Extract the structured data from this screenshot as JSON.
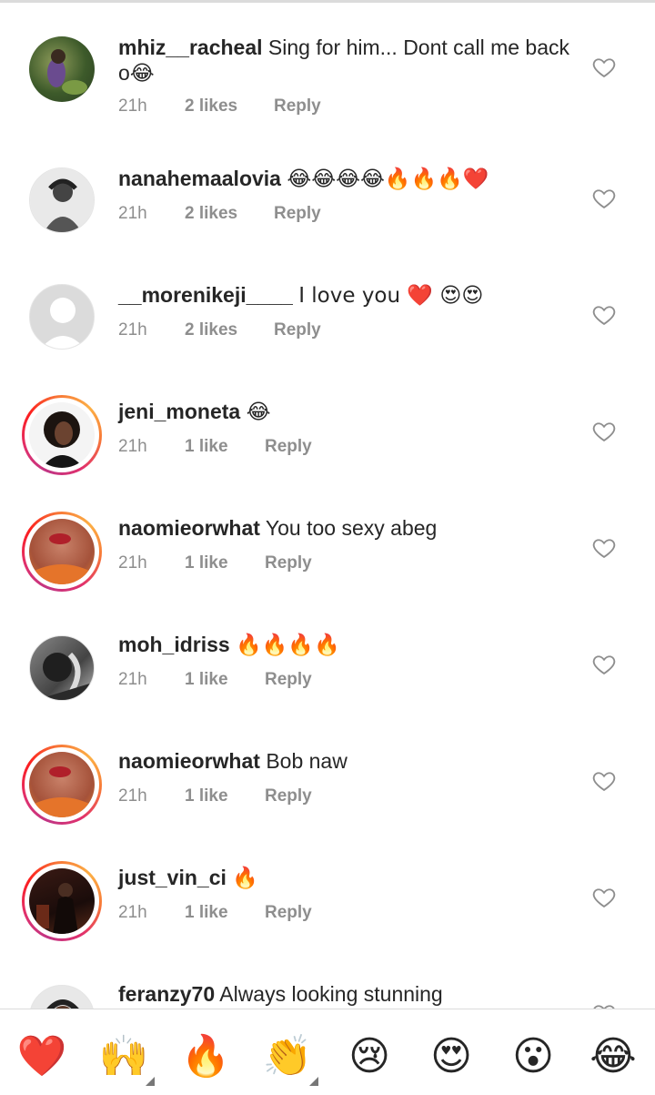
{
  "comments": [
    {
      "username": "mhiz__racheal",
      "text": "Sing for him... Dont call me back o😂",
      "time": "21h",
      "likes": "2 likes",
      "reply": "Reply",
      "avatar": "photo"
    },
    {
      "username": "nanahemaalovia",
      "text": "😂😂😂😂🔥🔥🔥❤️",
      "time": "21h",
      "likes": "2 likes",
      "reply": "Reply",
      "avatar": "photo"
    },
    {
      "username": "__morenikeji____",
      "text": "I love you ❤️ 😍😍",
      "time": "21h",
      "likes": "2 likes",
      "reply": "Reply",
      "avatar": "default-placeholder"
    },
    {
      "username": "jeni_moneta",
      "text": "😂",
      "time": "21h",
      "likes": "1 like",
      "reply": "Reply",
      "avatar": "story-ring"
    },
    {
      "username": "naomieorwhat",
      "text": "You too sexy abeg",
      "time": "21h",
      "likes": "1 like",
      "reply": "Reply",
      "avatar": "story-ring"
    },
    {
      "username": "moh_idriss",
      "text": "🔥🔥🔥🔥",
      "time": "21h",
      "likes": "1 like",
      "reply": "Reply",
      "avatar": "photo"
    },
    {
      "username": "naomieorwhat",
      "text": "Bob naw",
      "time": "21h",
      "likes": "1 like",
      "reply": "Reply",
      "avatar": "story-ring"
    },
    {
      "username": "just_vin_ci",
      "text": "🔥",
      "time": "21h",
      "likes": "1 like",
      "reply": "Reply",
      "avatar": "story-ring"
    },
    {
      "username": "feranzy70",
      "text": "Always looking stunning",
      "time": "",
      "likes": "",
      "reply": "",
      "avatar": "photo"
    }
  ],
  "emoji_bar": [
    {
      "emoji": "❤️",
      "icon": "red-heart-icon"
    },
    {
      "emoji": "🙌",
      "icon": "raising-hands-icon"
    },
    {
      "emoji": "🔥",
      "icon": "fire-icon"
    },
    {
      "emoji": "👏",
      "icon": "clapping-hands-icon"
    },
    {
      "emoji": "😢",
      "icon": "crying-face-icon"
    },
    {
      "emoji": "😍",
      "icon": "heart-eyes-icon"
    },
    {
      "emoji": "😮",
      "icon": "surprised-face-icon"
    },
    {
      "emoji": "😂",
      "icon": "tears-of-joy-icon"
    }
  ],
  "colors": {
    "username": "#262626",
    "meta": "#8e8e8e",
    "icon": "#8e8e8e",
    "ring_start": "#c13584",
    "ring_end": "#fcaf45"
  }
}
